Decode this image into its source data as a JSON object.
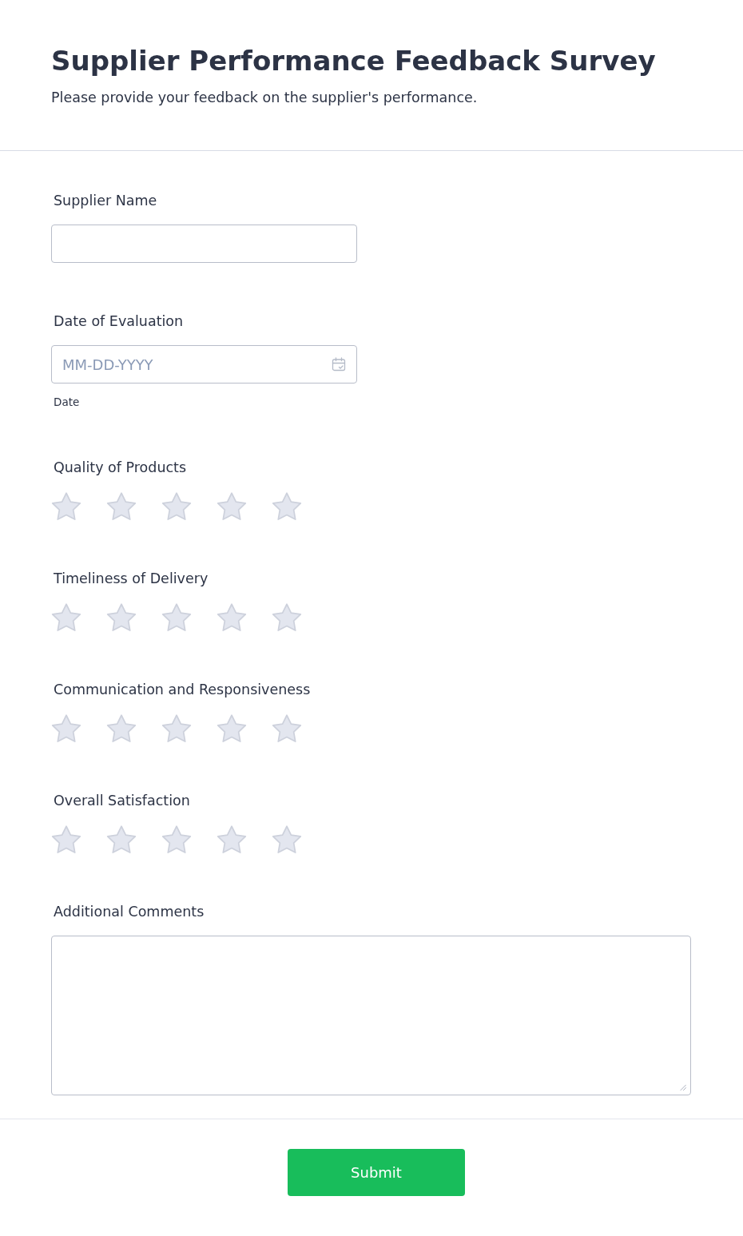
{
  "header": {
    "title": "Supplier Performance Feedback Survey",
    "subtitle": "Please provide your feedback on the supplier's performance."
  },
  "fields": [
    {
      "kind": "text",
      "label": "Supplier Name"
    },
    {
      "kind": "date",
      "label": "Date of Evaluation",
      "placeholder": "MM-DD-YYYY",
      "sublabel": "Date"
    },
    {
      "kind": "rating",
      "label": "Quality of Products",
      "stars": 0
    },
    {
      "kind": "rating",
      "label": "Timeliness of Delivery",
      "stars": 0
    },
    {
      "kind": "rating",
      "label": "Communication and Responsiveness",
      "stars": 0
    },
    {
      "kind": "rating",
      "label": "Overall Satisfaction",
      "stars": 0
    },
    {
      "kind": "textarea",
      "label": "Additional Comments"
    }
  ],
  "submit": {
    "label": "Submit"
  }
}
